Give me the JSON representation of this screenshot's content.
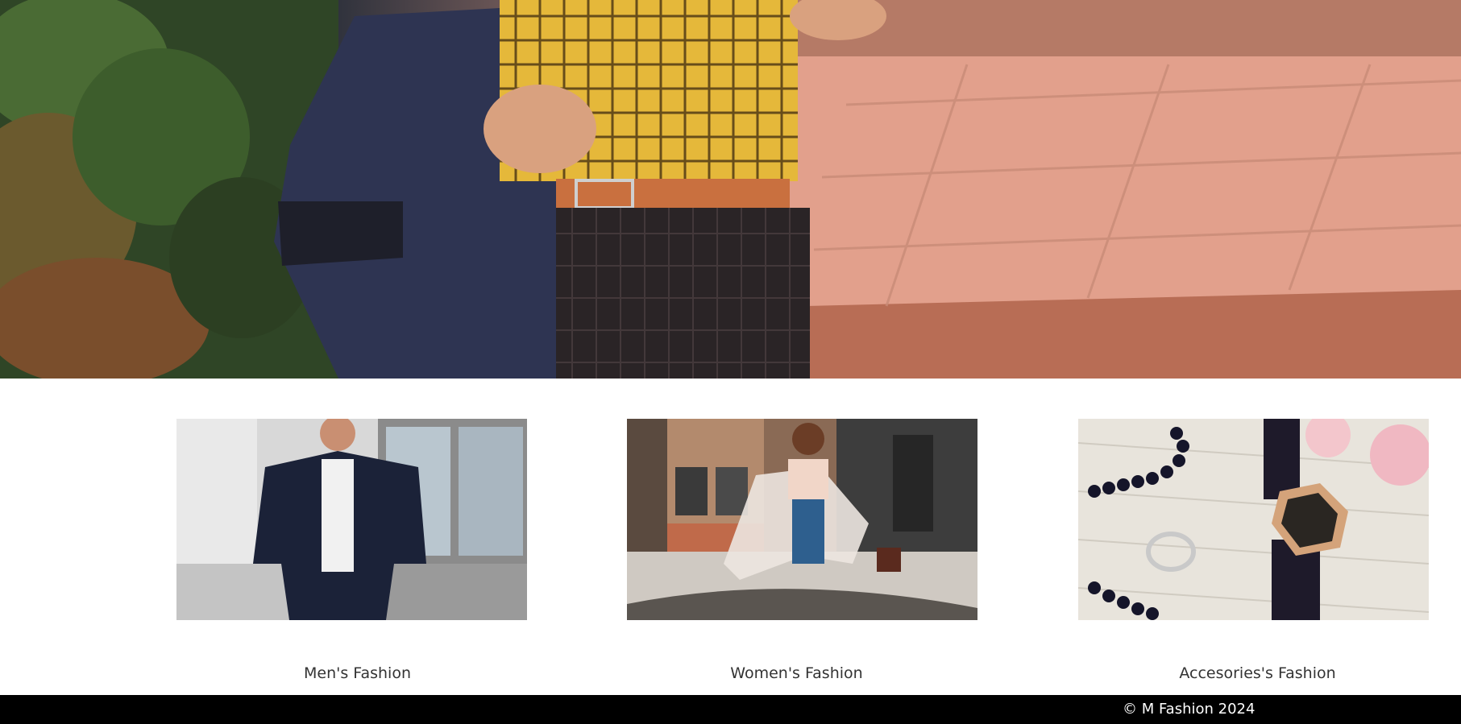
{
  "hero": {
    "image": "fashion-hero-photo"
  },
  "categories": [
    {
      "label": "Men's Fashion",
      "image": "mens-fashion-photo"
    },
    {
      "label": "Women's Fashion",
      "image": "womens-fashion-photo"
    },
    {
      "label": "Accesories's Fashion",
      "image": "accessories-fashion-photo"
    }
  ],
  "footer": {
    "copyright": "© M Fashion 2024"
  }
}
